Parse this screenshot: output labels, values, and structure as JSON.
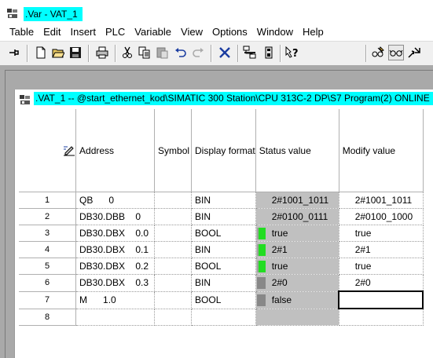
{
  "window": {
    "title": ".Var - VAT_1"
  },
  "menu": [
    "Table",
    "Edit",
    "Insert",
    "PLC",
    "Variable",
    "View",
    "Options",
    "Window",
    "Help"
  ],
  "toolbar": {
    "buttons": [
      "pin-icon",
      "new-icon",
      "open-icon",
      "save-icon",
      "print-icon",
      "cut-icon",
      "copy-icon",
      "paste-icon",
      "undo-icon",
      "redo-icon",
      "delete-icon",
      "monitor-network-icon",
      "plc-icon",
      "help-icon",
      "glasses-pencil-icon",
      "glasses-icon",
      "trigger-icon"
    ]
  },
  "child": {
    "title": ".VAT_1 -- @start_ethernet_kod\\SIMATIC 300 Station\\CPU 313C-2 DP\\S7 Program(2)  ONLINE"
  },
  "table": {
    "columns": [
      "Address",
      "Symbol",
      "Display format",
      "Status value",
      "Modify value"
    ],
    "rows": [
      {
        "num": "1",
        "address": "QB      0",
        "symbol": "",
        "format": "BIN",
        "status": "2#1001_1011",
        "led": "none",
        "modify": "2#1001_1011"
      },
      {
        "num": "2",
        "address": "DB30.DBB    0",
        "symbol": "",
        "format": "BIN",
        "status": "2#0100_0111",
        "led": "none",
        "modify": "2#0100_1000"
      },
      {
        "num": "3",
        "address": "DB30.DBX    0.0",
        "symbol": "",
        "format": "BOOL",
        "status": "true",
        "led": "green",
        "modify": "true"
      },
      {
        "num": "4",
        "address": "DB30.DBX    0.1",
        "symbol": "",
        "format": "BIN",
        "status": "2#1",
        "led": "green",
        "modify": "2#1"
      },
      {
        "num": "5",
        "address": "DB30.DBX    0.2",
        "symbol": "",
        "format": "BOOL",
        "status": "true",
        "led": "green",
        "modify": "true"
      },
      {
        "num": "6",
        "address": "DB30.DBX    0.3",
        "symbol": "",
        "format": "BIN",
        "status": "2#0",
        "led": "gray",
        "modify": "2#0"
      },
      {
        "num": "7",
        "address": "M      1.0",
        "symbol": "",
        "format": "BOOL",
        "status": "false",
        "led": "gray",
        "modify": ""
      },
      {
        "num": "8",
        "address": "",
        "symbol": "",
        "format": "",
        "status": "",
        "led": "none",
        "modify": ""
      }
    ]
  },
  "colors": {
    "title_highlight": "#00ffff",
    "led_true": "#22dd22",
    "led_false": "#888888",
    "status_bg": "#c0c0c0",
    "mdi_bg": "#a9a9a9"
  }
}
